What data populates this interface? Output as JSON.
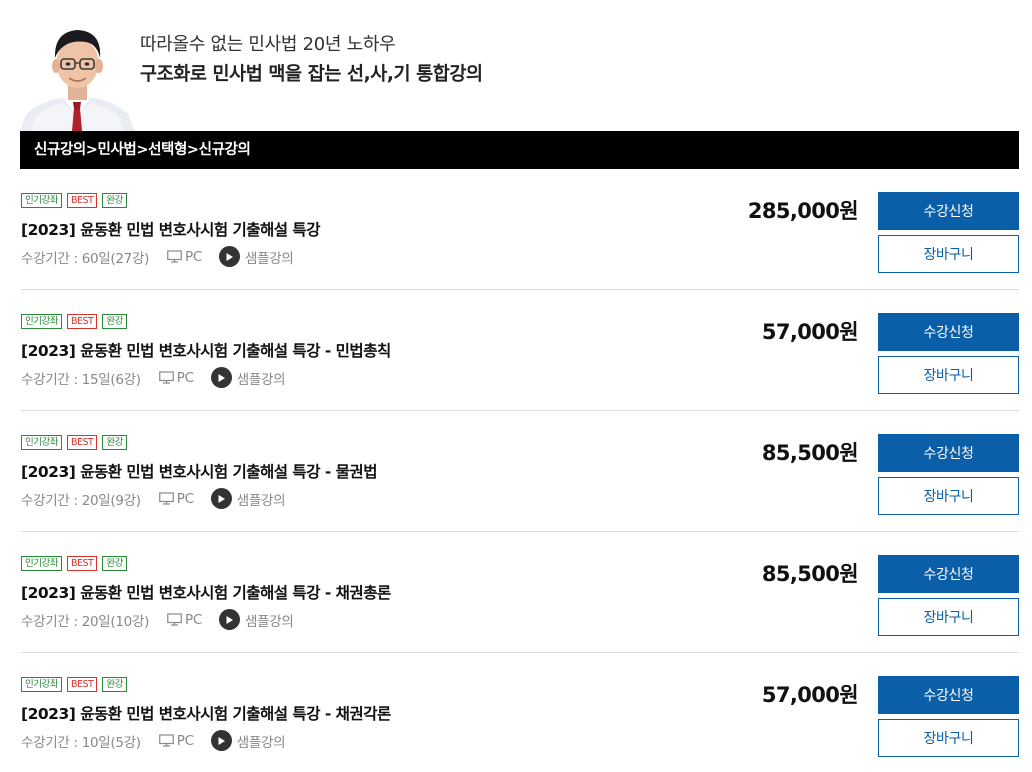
{
  "header": {
    "tagline": "따라올수 없는 민사법 20년 노하우",
    "headline": "구조화로 민사법 맥을 잡는 선,사,기 통합강의"
  },
  "breadcrumb": "신규강의>민사법>선택형>신규강의",
  "courses": [
    {
      "badges": [
        "인기강좌",
        "BEST",
        "완강"
      ],
      "title": "[2023] 윤동환 민법 변호사시험 기출해설 특강",
      "period": "수강기간 : 60일(27강)",
      "device": "PC",
      "sample": "샘플강의",
      "price": "285,000원",
      "apply": "수강신청",
      "cart": "장바구니"
    },
    {
      "badges": [
        "인기강좌",
        "BEST",
        "완강"
      ],
      "title": "[2023] 윤동환 민법 변호사시험 기출해설 특강 - 민법총칙",
      "period": "수강기간 : 15일(6강)",
      "device": "PC",
      "sample": "샘플강의",
      "price": "57,000원",
      "apply": "수강신청",
      "cart": "장바구니"
    },
    {
      "badges": [
        "인기강좌",
        "BEST",
        "완강"
      ],
      "title": "[2023] 윤동환 민법 변호사시험 기출해설 특강 - 물권법",
      "period": "수강기간 : 20일(9강)",
      "device": "PC",
      "sample": "샘플강의",
      "price": "85,500원",
      "apply": "수강신청",
      "cart": "장바구니"
    },
    {
      "badges": [
        "인기강좌",
        "BEST",
        "완강"
      ],
      "title": "[2023] 윤동환 민법 변호사시험 기출해설 특강 - 채권총론",
      "period": "수강기간 : 20일(10강)",
      "device": "PC",
      "sample": "샘플강의",
      "price": "85,500원",
      "apply": "수강신청",
      "cart": "장바구니"
    },
    {
      "badges": [
        "인기강좌",
        "BEST",
        "완강"
      ],
      "title": "[2023] 윤동환 민법 변호사시험 기출해설 특강 - 채권각론",
      "period": "수강기간 : 10일(5강)",
      "device": "PC",
      "sample": "샘플강의",
      "price": "57,000원",
      "apply": "수강신청",
      "cart": "장바구니"
    }
  ],
  "icons": {
    "device": "monitor-icon",
    "sample": "play-icon"
  },
  "colors": {
    "primary": "#0b5ea8",
    "breadcrumb_bg": "#000000",
    "badge_green": "#2a8a3a",
    "badge_red": "#d8342c"
  }
}
